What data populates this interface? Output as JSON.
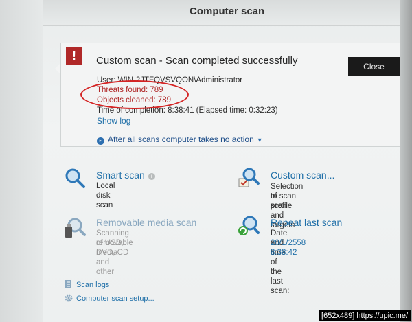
{
  "window": {
    "title": "Computer scan"
  },
  "status": {
    "title": "Custom scan - Scan completed successfully",
    "user_line": "User: WIN-2JTFQVSVQON\\Administrator",
    "threats_found": "Threats found: 789",
    "objects_cleaned": "Objects cleaned: 789",
    "completion": "Time of completion: 8:38:41 (Elapsed time: 0:32:23)",
    "show_log": "Show log",
    "after_scan": "After all scans computer takes no action",
    "close_label": "Close"
  },
  "actions": {
    "smart": {
      "title": "Smart scan",
      "desc": "Local disk scan"
    },
    "custom": {
      "title": "Custom scan...",
      "desc1": "Selection of scan profile and targets",
      "desc2": "to scan"
    },
    "removable": {
      "title": "Removable media scan",
      "desc1": "Scanning of USB, DVD, CD and other",
      "desc2": "removable media"
    },
    "repeat": {
      "title": "Repeat last scan",
      "desc1": "Date and time of the last scan:",
      "desc2": "20/1/2558 8:38:42"
    }
  },
  "footer": {
    "scan_logs": "Scan logs",
    "setup": "Computer scan setup..."
  },
  "watermark": "[652x489] https://upic.me/",
  "colors": {
    "accent": "#1f6fa8",
    "alert": "#b02828",
    "annotation": "#d42424"
  }
}
